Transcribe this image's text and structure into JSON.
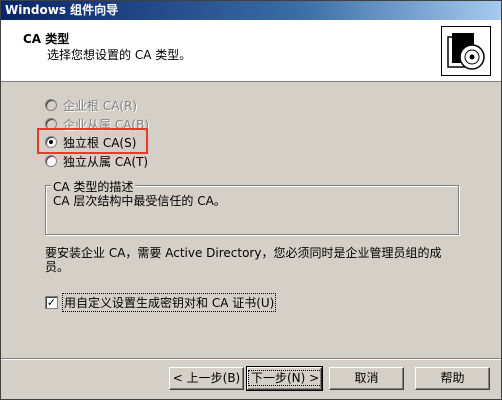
{
  "window": {
    "title": "Windows 组件向导"
  },
  "header": {
    "title": "CA 类型",
    "subtitle": "选择您想设置的 CA 类型。",
    "icon": "certificate-cd-icon"
  },
  "ca_types": [
    {
      "label": "企业根 CA(R)",
      "enabled": false,
      "selected": false
    },
    {
      "label": "企业从属 CA(B)",
      "enabled": false,
      "selected": false
    },
    {
      "label": "独立根 CA(S)",
      "enabled": true,
      "selected": true
    },
    {
      "label": "独立从属 CA(T)",
      "enabled": true,
      "selected": false
    }
  ],
  "description": {
    "title": "CA 类型的描述",
    "text": "CA 层次结构中最受信任的 CA。"
  },
  "note": "要安装企业 CA，需要 Active Directory，您必须同时是企业管理员组的成员。",
  "custom_keys": {
    "label": "用自定义设置生成密钥对和 CA 证书(U)",
    "checked": true
  },
  "buttons": {
    "back": "< 上一步(B)",
    "next": "下一步(N) >",
    "cancel": "取消",
    "help": "帮助"
  },
  "colors": {
    "highlight": "#e8392a",
    "title_bar": "#0a246a"
  }
}
